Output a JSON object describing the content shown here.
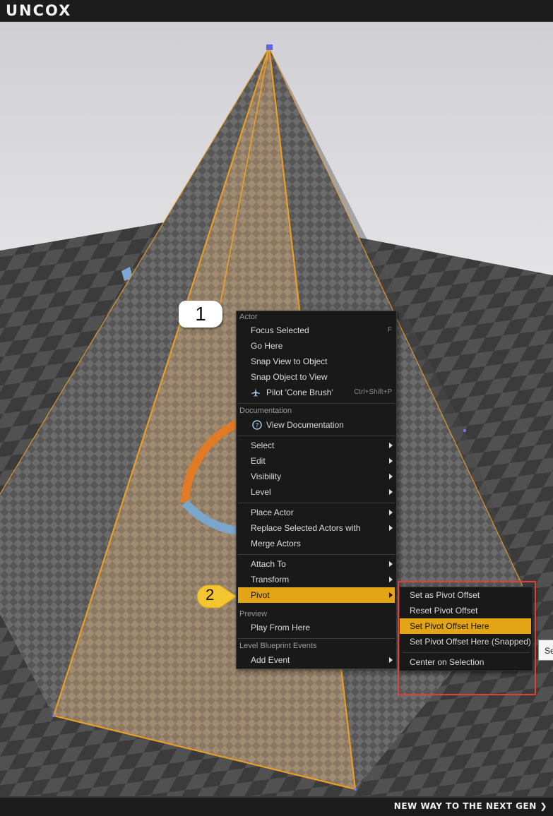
{
  "header": {
    "logo": "UNCOX"
  },
  "footer": {
    "tagline": "NEW WAY TO THE NEXT GEN ❯"
  },
  "callouts": {
    "one": "1",
    "two": "2"
  },
  "context_menu": {
    "actor_label": "Actor",
    "focus_selected": "Focus Selected",
    "focus_shortcut": "F",
    "go_here": "Go Here",
    "snap_view": "Snap View to Object",
    "snap_object": "Snap Object to View",
    "pilot": "Pilot 'Cone Brush'",
    "pilot_shortcut": "Ctrl+Shift+P",
    "documentation_label": "Documentation",
    "view_documentation": "View Documentation",
    "select": "Select",
    "edit": "Edit",
    "visibility": "Visibility",
    "level": "Level",
    "place_actor": "Place Actor",
    "replace_selected": "Replace Selected Actors with",
    "merge_actors": "Merge Actors",
    "attach_to": "Attach To",
    "transform": "Transform",
    "pivot": "Pivot",
    "preview_label": "Preview",
    "play_from_here": "Play From Here",
    "blueprint_label": "Level Blueprint Events",
    "add_event": "Add Event"
  },
  "pivot_submenu": {
    "set_as_pivot_offset": "Set as Pivot Offset",
    "reset_pivot_offset": "Reset Pivot Offset",
    "set_pivot_offset_here": "Set Pivot Offset Here",
    "set_pivot_offset_here_snapped": "Set Pivot Offset Here (Snapped)",
    "center_on_selection": "Center on Selection"
  },
  "tooltip": {
    "text": "Se"
  },
  "colors": {
    "highlight": "#e3a516",
    "selection_outline": "#f0a020",
    "annotation_box": "#e0403a"
  }
}
